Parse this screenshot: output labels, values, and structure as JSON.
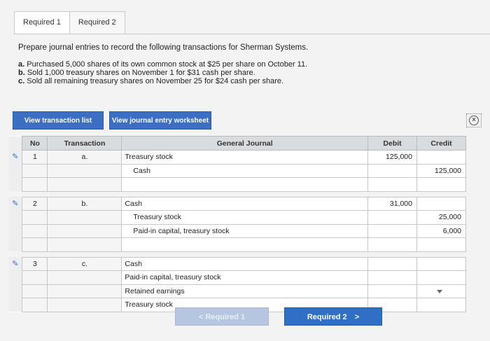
{
  "tabs": [
    {
      "label": "Required 1"
    },
    {
      "label": "Required 2"
    }
  ],
  "instructions": "Prepare journal entries to record the following transactions for Sherman Systems.",
  "transactions": [
    {
      "letter": "a.",
      "text": "Purchased 5,000 shares of its own common stock at $25 per share on October 11."
    },
    {
      "letter": "b.",
      "text": "Sold 1,000 treasury shares on November 1 for $31 cash per share."
    },
    {
      "letter": "c.",
      "text": "Sold all remaining treasury shares on November 25 for $24 cash per share."
    }
  ],
  "buttons": {
    "view_transactions": "View transaction list",
    "view_journal": "View journal entry worksheet"
  },
  "table": {
    "headers": {
      "no": "No",
      "transaction": "Transaction",
      "journal": "General Journal",
      "debit": "Debit",
      "credit": "Credit"
    },
    "rows": [
      {
        "no": "1",
        "tx": "a.",
        "account": "Treasury stock",
        "debit": "125,000",
        "credit": ""
      },
      {
        "no": "",
        "tx": "",
        "account": "Cash",
        "debit": "",
        "credit": "125,000"
      },
      {
        "no": "",
        "tx": "",
        "account": "",
        "debit": "",
        "credit": ""
      },
      {
        "no": "2",
        "tx": "b.",
        "account": "Cash",
        "debit": "31,000",
        "credit": ""
      },
      {
        "no": "",
        "tx": "",
        "account": "Treasury stock",
        "debit": "",
        "credit": "25,000"
      },
      {
        "no": "",
        "tx": "",
        "account": "Paid-in capital, treasury stock",
        "debit": "",
        "credit": "6,000"
      },
      {
        "no": "",
        "tx": "",
        "account": "",
        "debit": "",
        "credit": ""
      },
      {
        "no": "3",
        "tx": "c.",
        "account": "Cash",
        "debit": "",
        "credit": ""
      },
      {
        "no": "",
        "tx": "",
        "account": "Paid-in capital, treasury stock",
        "debit": "",
        "credit": ""
      },
      {
        "no": "",
        "tx": "",
        "account": "Retained earnings",
        "debit": "",
        "credit": ""
      },
      {
        "no": "",
        "tx": "",
        "account": "Treasury stock",
        "debit": "",
        "credit": ""
      }
    ]
  },
  "nav": {
    "prev": "Required 1",
    "next": "Required 2"
  }
}
